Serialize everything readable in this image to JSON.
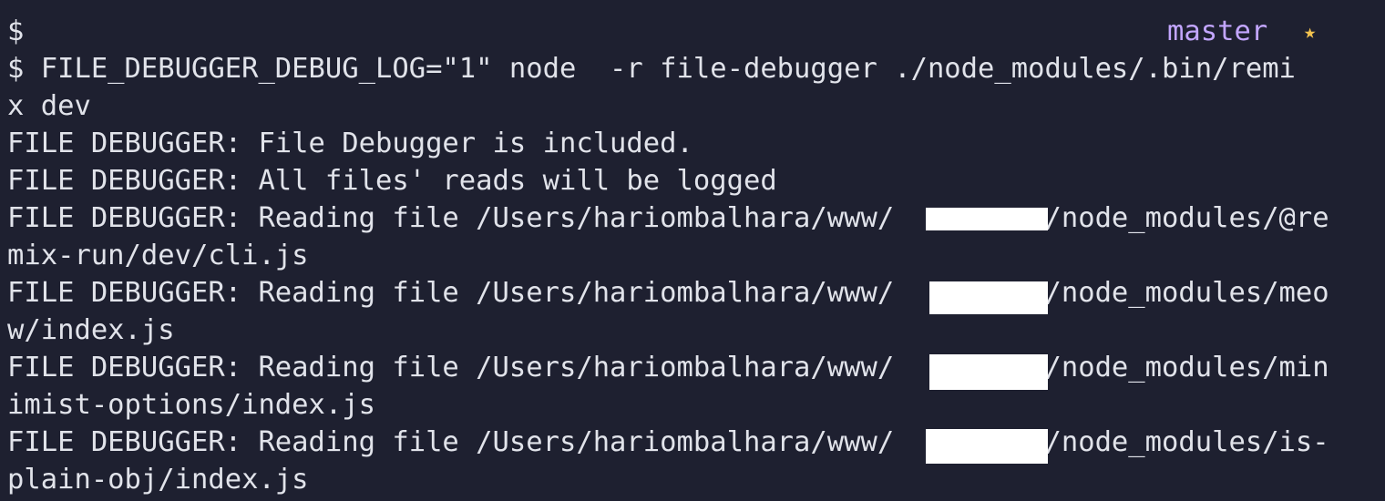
{
  "terminal": {
    "prompt_line": "$",
    "branch": "master",
    "status_glyph": "★",
    "lines": [
      "$ FILE_DEBUGGER_DEBUG_LOG=\"1\" node  -r file-debugger ./node_modules/.bin/remi",
      "x dev",
      "FILE DEBUGGER: File Debugger is included.",
      "FILE DEBUGGER: All files' reads will be logged",
      "FILE DEBUGGER: Reading file /Users/hariombalhara/www/         /node_modules/@re",
      "mix-run/dev/cli.js",
      "FILE DEBUGGER: Reading file /Users/hariombalhara/www/         /node_modules/meo",
      "w/index.js",
      "FILE DEBUGGER: Reading file /Users/hariombalhara/www/         /node_modules/min",
      "imist-options/index.js",
      "FILE DEBUGGER: Reading file /Users/hariombalhara/www/         /node_modules/is-",
      "plain-obj/index.js"
    ]
  },
  "colors": {
    "background": "#1e2030",
    "text": "#e1e3ea",
    "branch": "#c3a6ff",
    "star": "#f2c24f",
    "redaction": "#ffffff"
  }
}
